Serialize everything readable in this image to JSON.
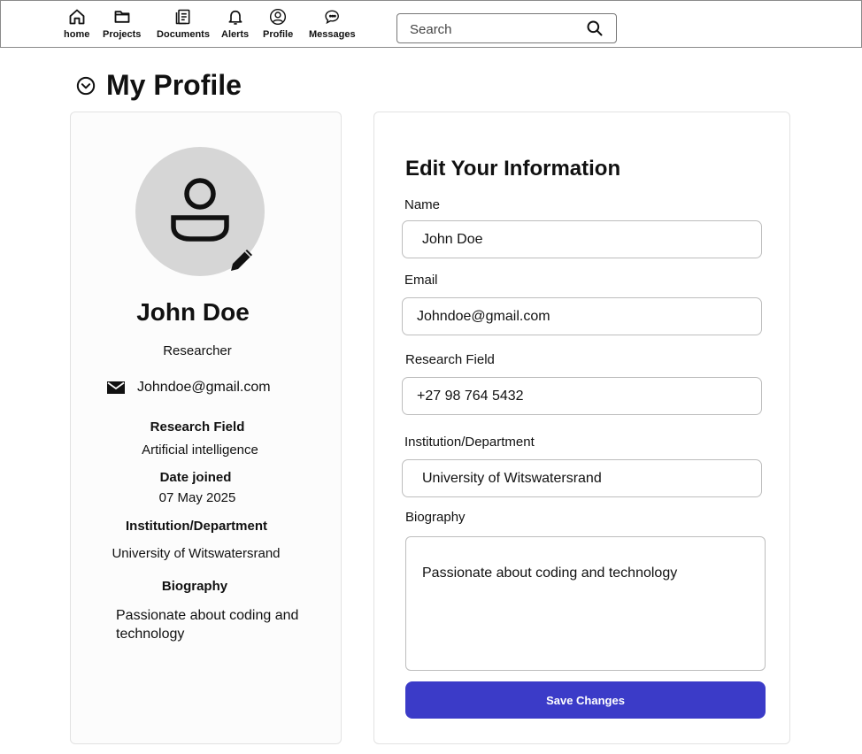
{
  "nav": {
    "items": [
      {
        "label": "home",
        "icon": "home-icon"
      },
      {
        "label": "Projects",
        "icon": "folder-icon"
      },
      {
        "label": "Documents",
        "icon": "documents-icon"
      },
      {
        "label": "Alerts",
        "icon": "bell-icon"
      },
      {
        "label": "Profile",
        "icon": "user-circle-icon"
      },
      {
        "label": "Messages",
        "icon": "chat-bubble-icon"
      }
    ],
    "search_placeholder": "Search"
  },
  "page": {
    "title": "My Profile"
  },
  "profile_card": {
    "name": "John Doe",
    "role": "Researcher",
    "email": "Johndoe@gmail.com",
    "research_field_label": "Research Field",
    "research_field_value": "Artificial intelligence",
    "date_joined_label": "Date joined",
    "date_joined_value": "07 May 2025",
    "institution_label": "Institution/Department",
    "institution_value": "University of Witswatersrand",
    "biography_label": "Biography",
    "biography_value": "Passionate about coding and technology"
  },
  "form": {
    "title": "Edit Your Information",
    "name_label": "Name",
    "name_value": "John Doe",
    "email_label": "Email",
    "email_value": "Johndoe@gmail.com",
    "research_field_label": "Research Field",
    "research_field_value": "+27 98 764 5432",
    "institution_label": "Institution/Department",
    "institution_value": "University of Witswatersrand",
    "biography_label": "Biography",
    "biography_value": "Passionate about coding and technology",
    "save_label": "Save Changes"
  },
  "colors": {
    "primary_button": "#3b3bc8",
    "avatar_bg": "#d6d6d6"
  }
}
